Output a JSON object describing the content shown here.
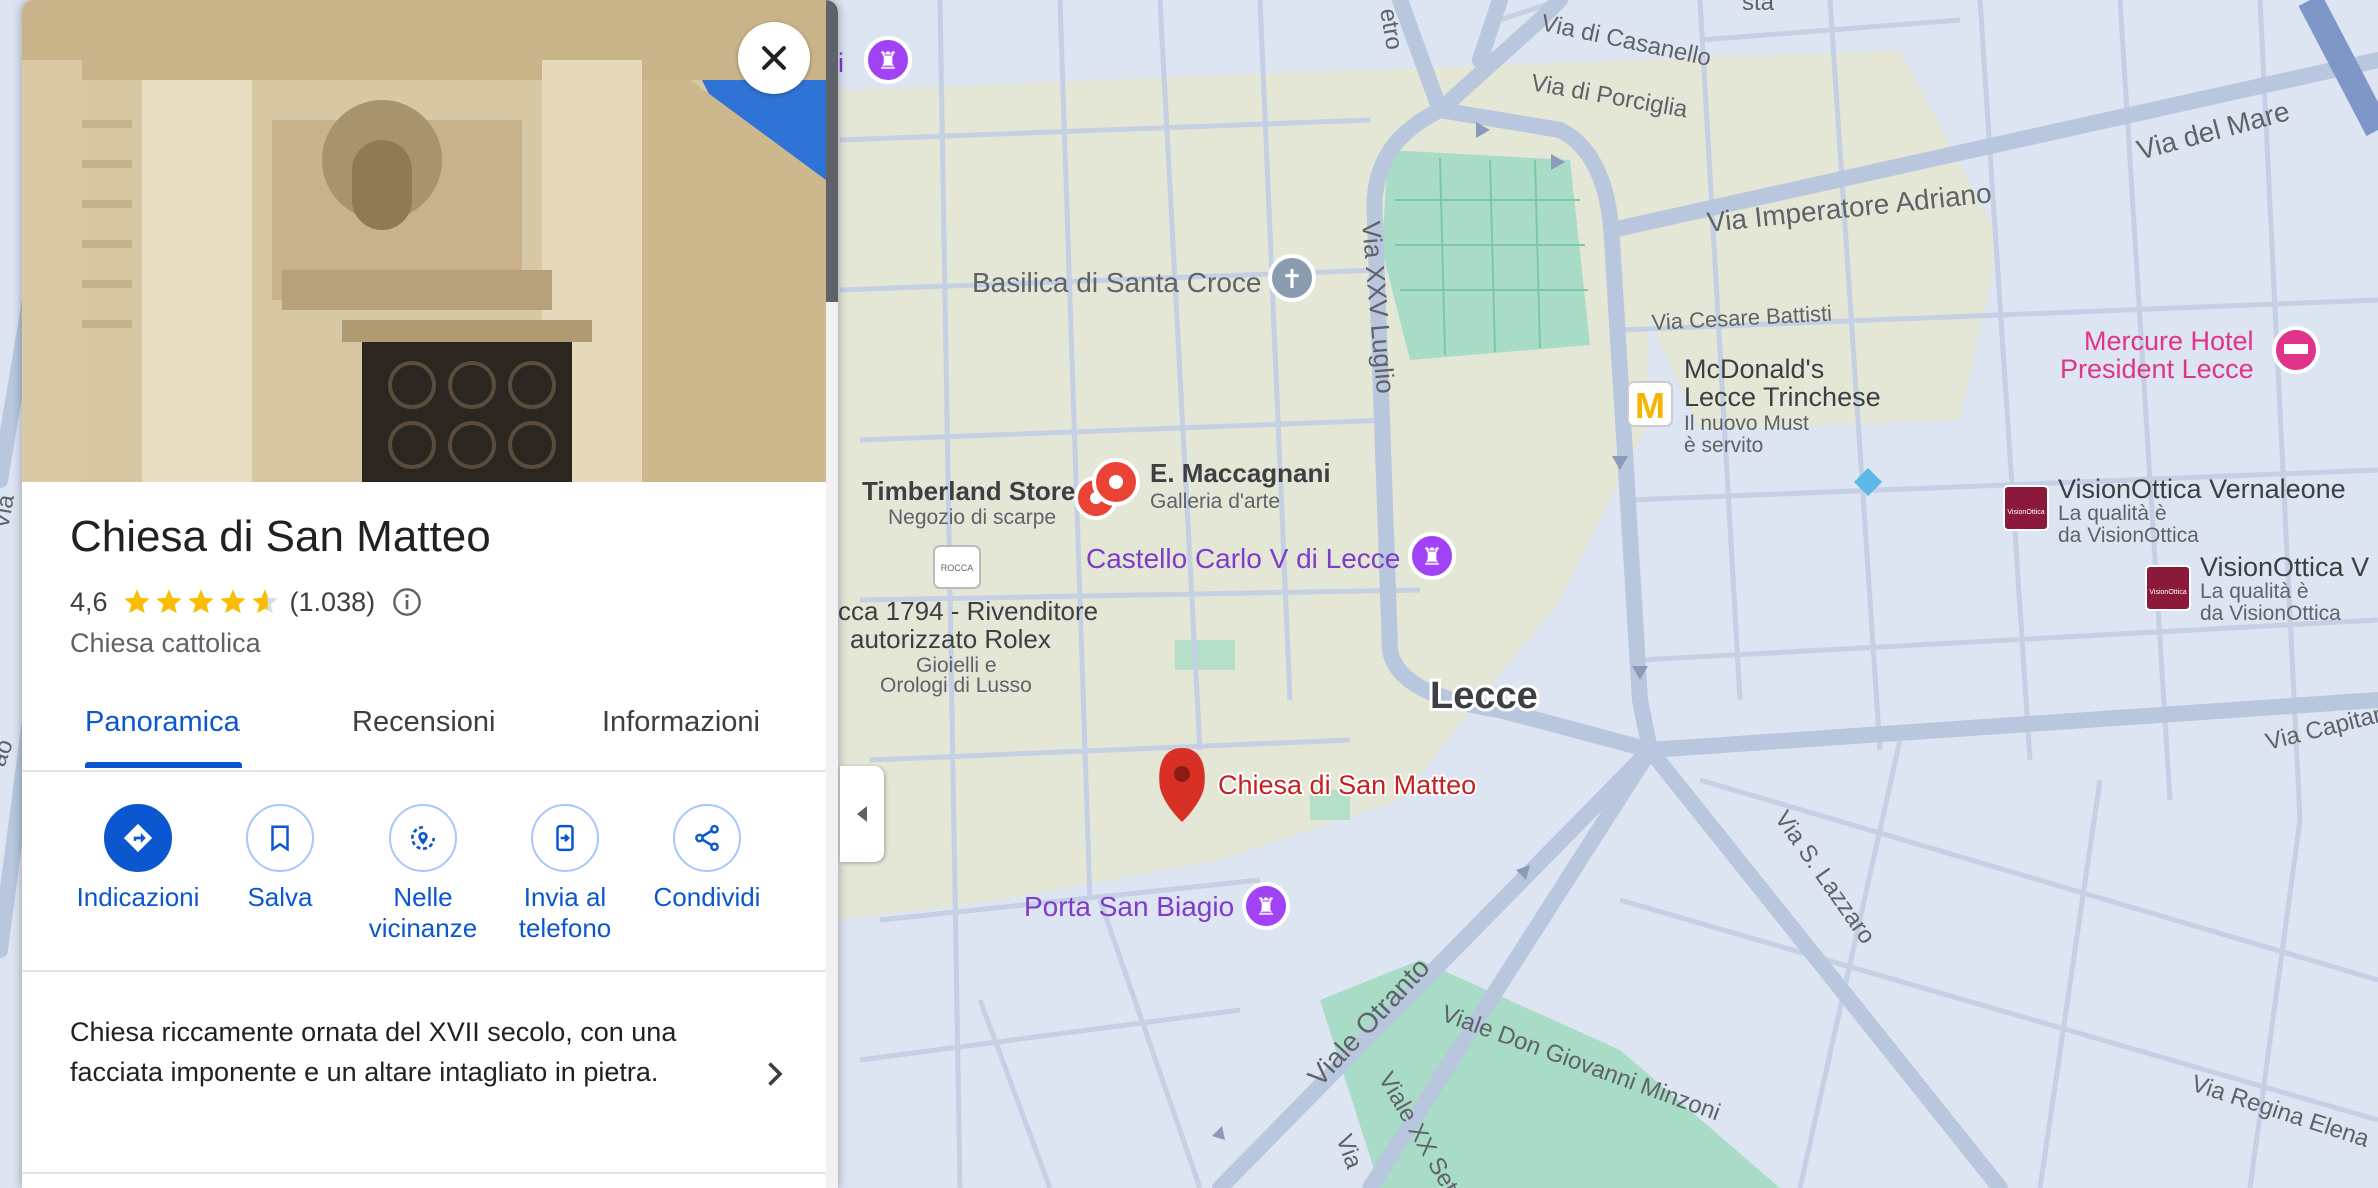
{
  "place": {
    "title": "Chiesa di San Matteo",
    "rating": "4,6",
    "stars": 4.6,
    "review_count": "(1.038)",
    "category": "Chiesa cattolica",
    "description": "Chiesa riccamente ornata del XVII secolo, con una facciata imponente e un altare intagliato in pietra."
  },
  "tabs": [
    {
      "label": "Panoramica",
      "active": true
    },
    {
      "label": "Recensioni",
      "active": false
    },
    {
      "label": "Informazioni",
      "active": false
    }
  ],
  "actions": [
    {
      "label": "Indicazioni",
      "icon": "directions-icon"
    },
    {
      "label": "Salva",
      "icon": "bookmark-icon"
    },
    {
      "label": "Nelle vicinanze",
      "icon": "nearby-icon"
    },
    {
      "label": "Invia al telefono",
      "icon": "send-to-phone-icon"
    },
    {
      "label": "Condividi",
      "icon": "share-icon"
    }
  ],
  "map": {
    "city_label": "Lecce",
    "pois": {
      "partial_top": "li",
      "basilica": "Basilica di Santa Croce",
      "timberland": "Timberland Store",
      "timberland_sub": "Negozio di scarpe",
      "maccagnani": "E. Maccagnani",
      "maccagnani_sub": "Galleria d'arte",
      "castello": "Castello Carlo V di Lecce",
      "rocca_line1": "cca 1794 - Rivenditore",
      "rocca_line2": "autorizzato Rolex",
      "rocca_sub1": "Gioielli e",
      "rocca_sub2": "Orologi di Lusso",
      "rocca_logo": "ROCCA",
      "mcdonalds_line1": "McDonald's",
      "mcdonalds_line2": "Lecce Trinchese",
      "mcdonalds_sub1": "Il nuovo Must",
      "mcdonalds_sub2": "è servito",
      "mercure_line1": "Mercure Hotel",
      "mercure_line2": "President Lecce",
      "vision1": "VisionOttica Vernaleone",
      "vision1_sub1": "La qualità è",
      "vision1_sub2": "da VisionOttica",
      "vision2": "VisionOttica V",
      "vision2_sub1": "La qualità è",
      "vision2_sub2": "da VisionOttica",
      "vision_logo": "VisionOttica",
      "selected": "Chiesa di San Matteo",
      "porta": "Porta San Biagio"
    },
    "streets": {
      "casanello": "Via di Casanello",
      "porciglia": "Via di Porciglia",
      "mare": "Via del Mare",
      "adriano": "Via Imperatore Adriano",
      "xxv_luglio": "Via XXV Luglio",
      "battisti": "Via Cesare Battisti",
      "capitano": "Via Capitan",
      "s_lazzaro": "Via S. Lazzaro",
      "otranto": "Viale Otranto",
      "minzoni": "Viale Don Giovanni Minzoni",
      "regina_elena": "Via Regina Elena",
      "xx_sett": "Viale XX Sette",
      "etro": "etro",
      "sta": "sta",
      "via_left": "Via",
      "via_left2": "Via",
      "ao": "ao",
      "via_bottom": "Via"
    },
    "colors": {
      "road": "#b8c6de",
      "background": "#dde4f2",
      "park": "#a8dcc6",
      "district": "#e3e6d8",
      "selected_pin": "#d93025",
      "poi_purple": "#7e3ccb",
      "poi_pink": "#e0338a"
    }
  }
}
